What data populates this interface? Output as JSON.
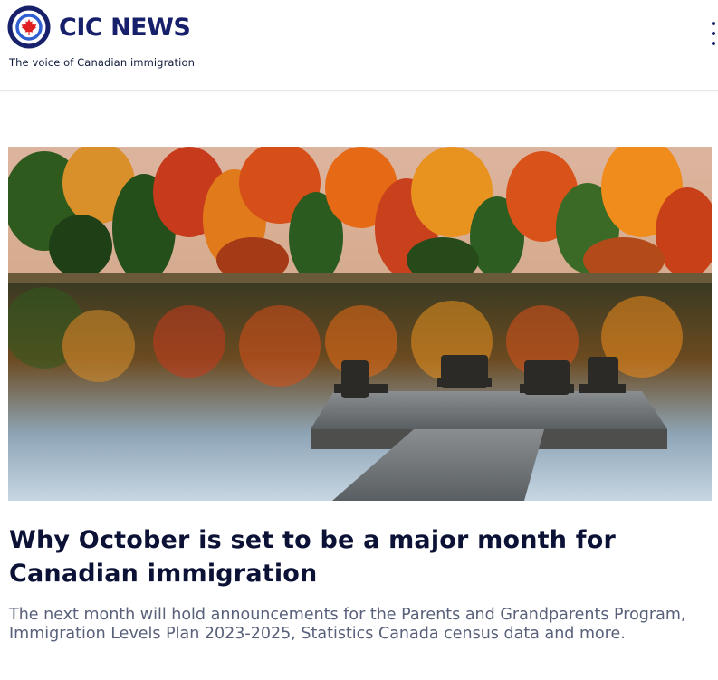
{
  "site": {
    "name": "CIC NEWS",
    "tagline": "The voice of Canadian immigration",
    "logo_icon": "maple-leaf-ring-logo",
    "brand_color": "#17206a",
    "accent_color": "#e02020"
  },
  "header": {
    "menu_icon": "vertical-dots-icon"
  },
  "article": {
    "image_subject": "Wooden dock with Adirondack chairs on a lake with autumn forest reflection",
    "title": "Why October is set to be a major month for Canadian immigration",
    "summary": "The next month will hold announcements for the Parents and Grandparents Program, Immigration Levels Plan 2023-2025, Statistics Canada census data and more."
  }
}
